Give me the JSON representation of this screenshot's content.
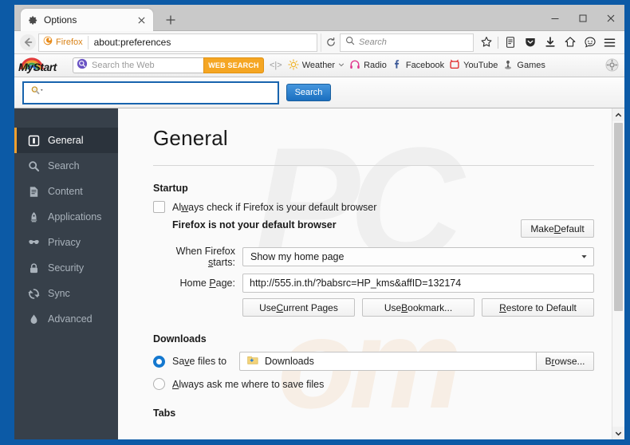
{
  "window": {
    "frame_color": "#0c5aa6",
    "controls": {
      "minimize": "minimize-button",
      "maximize": "maximize-button",
      "close": "close-button"
    }
  },
  "tabbar": {
    "tab_title": "Options",
    "tab_icon": "gear-icon",
    "close_icon": "close-icon",
    "new_tab_icon": "plus-icon"
  },
  "navbar": {
    "back_icon": "back-arrow-icon",
    "identity_label": "Firefox",
    "identity_icon": "firefox-logo-icon",
    "url": "about:preferences",
    "reload_icon": "reload-icon",
    "search_placeholder": "Search",
    "search_icon": "search-icon",
    "icons": [
      {
        "name": "bookmark-star-icon",
        "glyph": "star"
      },
      {
        "name": "reader-list-icon",
        "glyph": "list"
      },
      {
        "name": "pocket-icon",
        "glyph": "shield"
      },
      {
        "name": "downloads-icon",
        "glyph": "down-arrow"
      },
      {
        "name": "home-icon",
        "glyph": "home"
      },
      {
        "name": "sync-chat-icon",
        "glyph": "smiley"
      },
      {
        "name": "menu-hamburger-icon",
        "glyph": "hamburger"
      }
    ]
  },
  "mystart_toolbar": {
    "brand": "MyStart",
    "brand_icon": "mystart-rainbow-icon",
    "search_placeholder": "Search the Web",
    "search_icon": "search-magnifier-icon",
    "web_search_label": "WEB SEARCH",
    "web_search_color": "#f5a623",
    "divider": "<|>",
    "links": [
      {
        "label": "Weather",
        "icon": "sun-icon",
        "has_dropdown": true
      },
      {
        "label": "Radio",
        "icon": "headphones-icon",
        "has_dropdown": false
      },
      {
        "label": "Facebook",
        "icon": "facebook-f-icon",
        "has_dropdown": false
      },
      {
        "label": "YouTube",
        "icon": "tv-icon",
        "has_dropdown": false
      },
      {
        "label": "Games",
        "icon": "joystick-icon",
        "has_dropdown": false
      }
    ],
    "settings_icon": "gear-icon"
  },
  "search_bar_row": {
    "input_value": "",
    "input_icon": "magnifier-dropdown-icon",
    "button_label": "Search",
    "button_color": "#1b6fc0",
    "border_color": "#1864ae"
  },
  "sidebar": {
    "items": [
      {
        "label": "General",
        "icon": "general-icon",
        "selected": true
      },
      {
        "label": "Search",
        "icon": "search-icon",
        "selected": false
      },
      {
        "label": "Content",
        "icon": "content-page-icon",
        "selected": false
      },
      {
        "label": "Applications",
        "icon": "rocket-icon",
        "selected": false
      },
      {
        "label": "Privacy",
        "icon": "mask-icon",
        "selected": false
      },
      {
        "label": "Security",
        "icon": "lock-icon",
        "selected": false
      },
      {
        "label": "Sync",
        "icon": "sync-icon",
        "selected": false
      },
      {
        "label": "Advanced",
        "icon": "gear-flask-icon",
        "selected": false
      }
    ],
    "background": "#37404a",
    "selected_background": "#2b333c",
    "accent_color": "#f0a030"
  },
  "main": {
    "title": "General",
    "startup": {
      "heading": "Startup",
      "check_default_label": "Always check if Firefox is your default browser",
      "check_default_checked": false,
      "default_status": "Firefox is not your default browser",
      "make_default_label": "Make Default",
      "when_starts_label": "When Firefox starts:",
      "when_starts_value": "Show my home page",
      "homepage_label": "Home Page:",
      "homepage_value": "http://555.in.th/?babsrc=HP_kms&affID=132174",
      "buttons": [
        "Use Current Pages",
        "Use Bookmark...",
        "Restore to Default"
      ]
    },
    "downloads": {
      "heading": "Downloads",
      "save_to_label": "Save files to",
      "save_to_selected": true,
      "folder_value": "Downloads",
      "folder_icon": "folder-download-icon",
      "browse_label": "Browse...",
      "always_ask_label": "Always ask me where to save files",
      "always_ask_selected": false
    },
    "tabs_heading": "Tabs"
  },
  "scrollbar": {
    "up_icon": "chevron-up-icon",
    "down_icon": "chevron-down-icon"
  }
}
